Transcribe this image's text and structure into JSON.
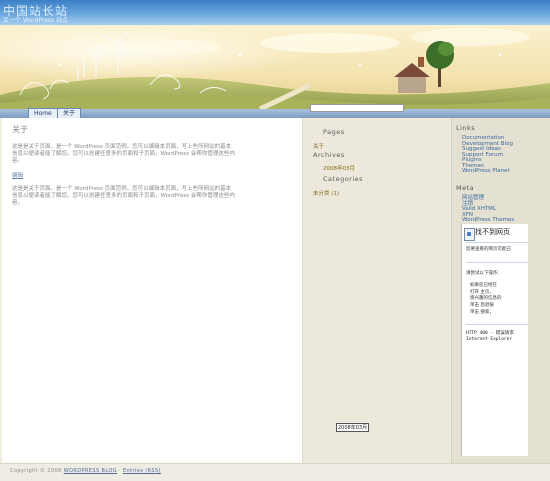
{
  "header": {
    "site_title": "中国站长站",
    "site_desc": "又一个 WordPress 站点"
  },
  "nav": {
    "home": "Home",
    "about": "关于"
  },
  "search": {
    "value": ""
  },
  "post": {
    "title": "关于",
    "paragraph_1_line_1": "这是是关于页面。是一个 WordPress 页面范例。您可以编辑本页面，写上些所网站的基本",
    "paragraph_1_line_2": "信息以便读者能了解您。您可以创建任意多的页面和子页面，WordPress 会帮你管理这些内",
    "paragraph_1_line_3": "容。",
    "edit_link": "编辑",
    "paragraph_2_line_1": "这是是关于页面。是一个 WordPress 页面范例。您可以编辑本页面，写上些所网站的基本",
    "paragraph_2_line_2": "信息以便读者能了解您。您可以创建任意多的页面和子页面，WordPress 会帮你管理这些内",
    "paragraph_2_line_3": "容。"
  },
  "middle": {
    "pages_heading": "Pages",
    "pages_item": "关于",
    "archives_heading": "Archives",
    "archives_item": "2008年03月",
    "categories_heading": "Categories",
    "categories_item": "未分类 (1)",
    "calendar_caption": "2008年03月"
  },
  "right": {
    "links_heading": "Links",
    "links": [
      "Documentation",
      "Development Blog",
      "Suggest Ideas",
      "Support Forum",
      "Plugins",
      "Themes",
      "WordPress Planet"
    ],
    "meta_heading": "Meta",
    "meta": [
      "网站管理",
      "注销",
      "Valid XHTML",
      "XFN",
      "WordPress Themes"
    ]
  },
  "error_frame": {
    "title": "找不到网页",
    "line_1": "您要查看的网页可能已",
    "line_2": "请尝试以下操作：",
    "bullet_1": "如果您已经在",
    "bullet_2": "打开 主页，",
    "bullet_2b": "感兴趣的信息的",
    "bullet_3": "单击 后退按",
    "bullet_4": "单击 搜索，",
    "code_1": "HTTP 400 - 错误请求",
    "code_2": "Internet Explorer"
  },
  "footer": {
    "prefix": "Copyright © 2008",
    "blog_link": "WORDPRESS BLOG",
    "sep": "·",
    "entries": "Entries (RSS)"
  },
  "colors": {
    "sky": "#3b7fc6",
    "page_bg": "#f1ede1",
    "link": "#3b6a9e",
    "accent_gold": "#8a6a1a"
  }
}
